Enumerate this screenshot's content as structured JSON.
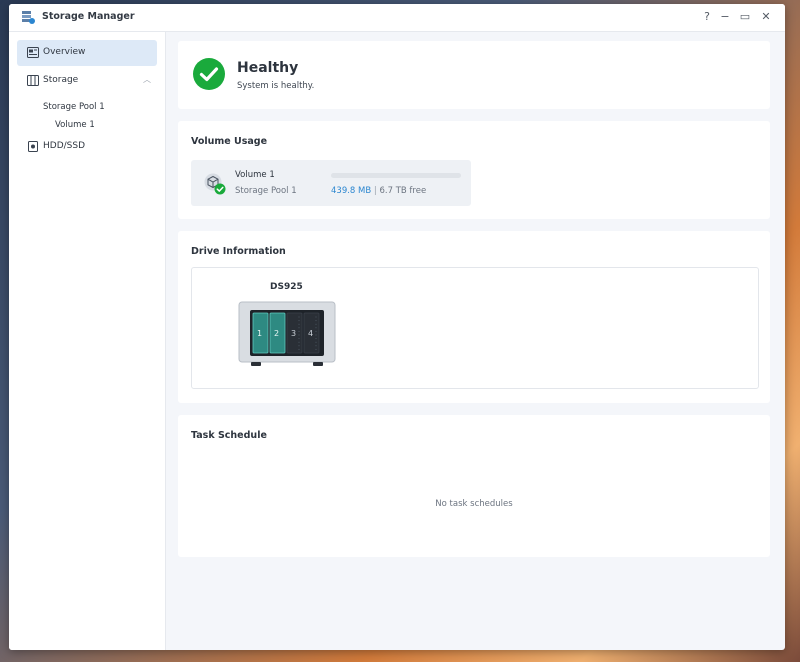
{
  "window": {
    "title": "Storage Manager",
    "controls": {
      "help": "?",
      "minimize": "−",
      "maximize": "▭",
      "close": "✕"
    }
  },
  "sidebar": {
    "items": [
      {
        "label": "Overview",
        "icon": "overview-icon",
        "active": true
      },
      {
        "label": "Storage",
        "icon": "storage-icon",
        "expanded": true,
        "children": [
          {
            "label": "Storage Pool 1",
            "children": [
              {
                "label": "Volume 1"
              }
            ]
          }
        ]
      },
      {
        "label": "HDD/SSD",
        "icon": "drive-icon"
      }
    ]
  },
  "health": {
    "status": "Healthy",
    "message": "System is healthy.",
    "status_color": "#1aaa3c",
    "icon": "check-circle-icon"
  },
  "volume_usage": {
    "title": "Volume Usage",
    "volume": {
      "name": "Volume 1",
      "pool": "Storage Pool 1",
      "used": "439.8 MB",
      "separator": "|",
      "free": "6.7 TB free",
      "usage_fraction": 0.0001
    }
  },
  "drive_info": {
    "title": "Drive Information",
    "model": "DS925",
    "bays": [
      "1",
      "2",
      "3",
      "4"
    ],
    "bay_colors": {
      "installed": "#2e8a82",
      "empty": "#2a2f36"
    }
  },
  "task_schedule": {
    "title": "Task Schedule",
    "empty_message": "No task schedules"
  },
  "colors": {
    "accent": "#2b86d0",
    "sidebar_active": "#dde9f7",
    "healthy": "#1aaa3c"
  }
}
